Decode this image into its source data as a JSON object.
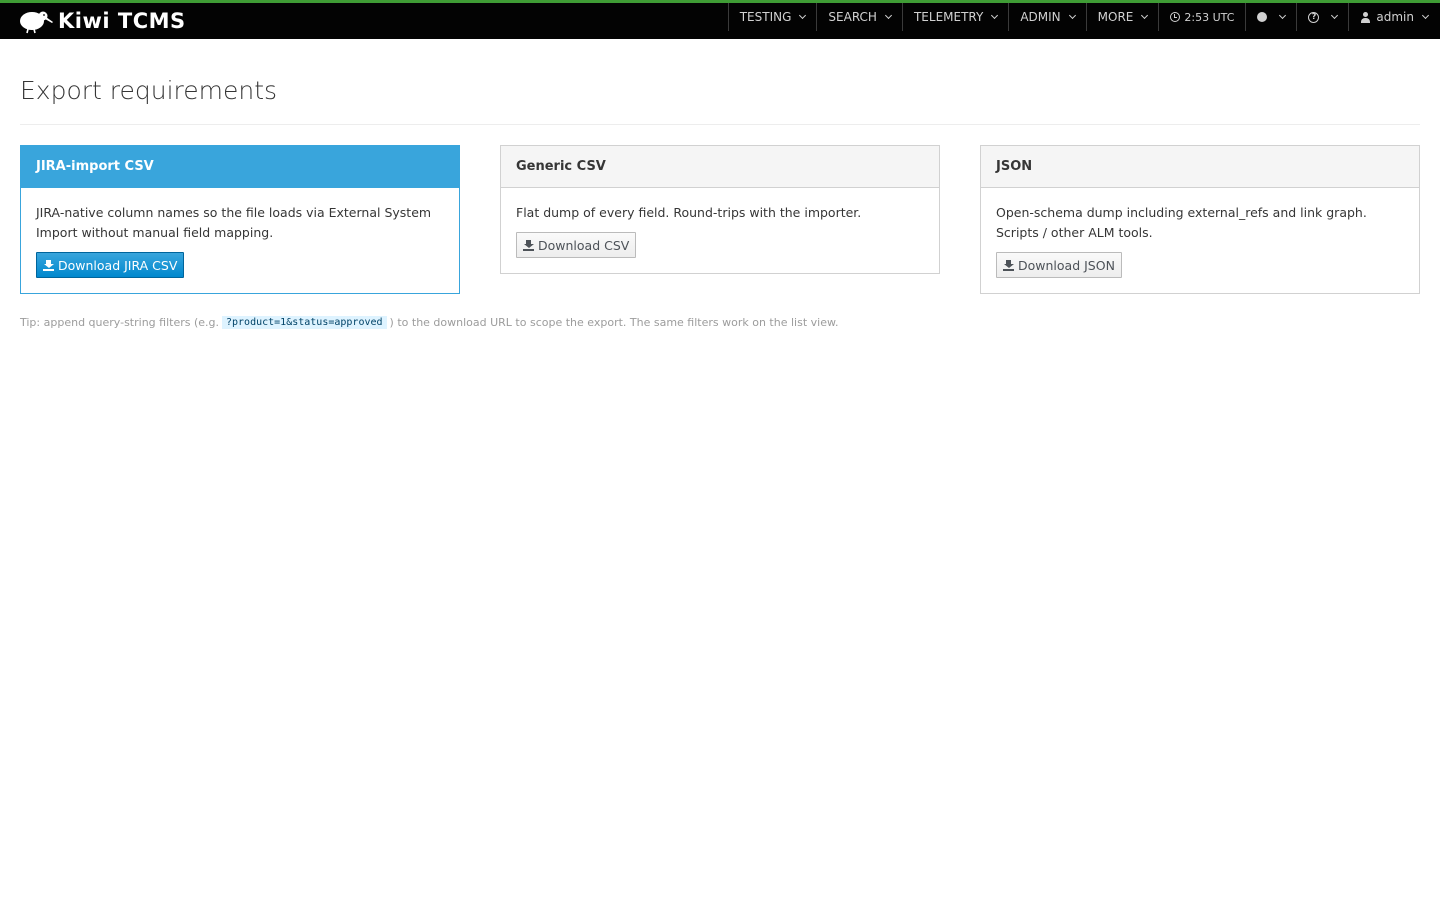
{
  "colors": {
    "navbar_bg": "#030303",
    "navbar_accent": "#3f9c35",
    "primary": "#39a5dc",
    "primary_button": "#0088ce",
    "code_bg": "#def3ff"
  },
  "navbar": {
    "brand": "Kiwi TCMS",
    "logo_icon": "kiwi-bird-icon",
    "items": [
      {
        "label": "TESTING"
      },
      {
        "label": "SEARCH"
      },
      {
        "label": "TELEMETRY"
      },
      {
        "label": "ADMIN"
      },
      {
        "label": "MORE"
      }
    ],
    "clock": "2:53 UTC",
    "user": "admin"
  },
  "page": {
    "title": "Export requirements"
  },
  "cards": [
    {
      "title": "JIRA-import CSV",
      "description": "JIRA-native column names so the file loads via External System Import without manual field mapping.",
      "button": "Download JIRA CSV"
    },
    {
      "title": "Generic CSV",
      "description": "Flat dump of every field. Round-trips with the importer.",
      "button": "Download CSV"
    },
    {
      "title": "JSON",
      "description": "Open-schema dump including external_refs and link graph. Scripts / other ALM tools.",
      "button": "Download JSON"
    }
  ],
  "tip": {
    "before": "Tip: append query-string filters (e.g.",
    "code": "?product=1&status=approved",
    "after": ") to the download URL to scope the export. The same filters work on the list view."
  }
}
